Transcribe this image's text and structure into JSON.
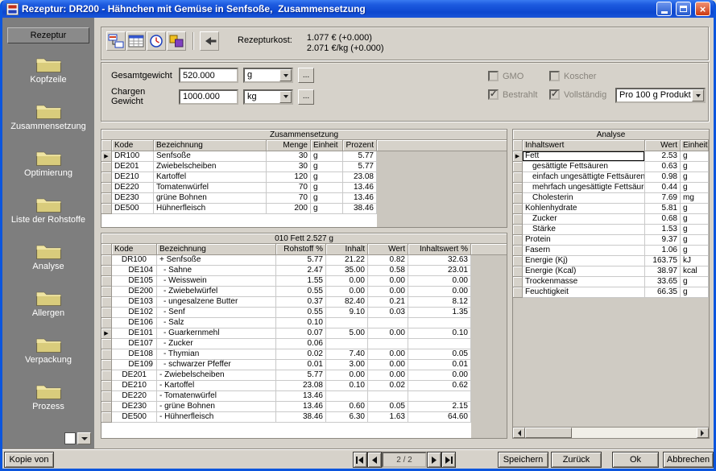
{
  "window": {
    "title": "Rezeptur: DR200 - Hähnchen mit Gemüse in Senfsoße,  Zusammensetzung"
  },
  "colors": {
    "titlebar_blue": "#1d5be0",
    "window_bg": "#d6d2ca",
    "sidebar_gray": "#7e7e7e",
    "folder_yellow": "#d9cc7c"
  },
  "sidebar": {
    "header": "Rezeptur",
    "items": [
      {
        "label": "Kopfzeile"
      },
      {
        "label": "Zusammensetzung"
      },
      {
        "label": "Optimierung"
      },
      {
        "label": "Liste der Rohstoffe"
      },
      {
        "label": "Analyse"
      },
      {
        "label": "Allergen"
      },
      {
        "label": "Verpackung"
      },
      {
        "label": "Prozess"
      }
    ]
  },
  "toolbar": {
    "cost_label": "Rezepturkost:",
    "cost_line1": "1.077 € (+0.000)",
    "cost_line2": "2.071 €/kg (+0.000)"
  },
  "form": {
    "gesamtgewicht": {
      "label": "Gesamtgewicht",
      "value": "520.000",
      "unit": "g"
    },
    "chargen": {
      "label": "Chargen Gewicht",
      "value": "1000.000",
      "unit": "kg"
    },
    "browse_label": "...",
    "checkboxes": [
      {
        "label": "GMO",
        "checked": false
      },
      {
        "label": "Koscher",
        "checked": false
      },
      {
        "label": "Bestrahlt",
        "checked": true
      },
      {
        "label": "Vollständig",
        "checked": true
      }
    ],
    "per_unit_dropdown": "Pro 100 g Produkt"
  },
  "composition_table": {
    "title": "Zusammensetzung",
    "columns": {
      "kode": "Kode",
      "bezeichnung": "Bezeichnung",
      "menge": "Menge",
      "einheit": "Einheit",
      "prozent": "Prozent"
    },
    "rows": [
      {
        "kode": "DR100",
        "bezeichnung": "Senfsoße",
        "menge": "30",
        "einheit": "g",
        "prozent": "5.77",
        "current": true
      },
      {
        "kode": "DE201",
        "bezeichnung": "Zwiebelscheiben",
        "menge": "30",
        "einheit": "g",
        "prozent": "5.77"
      },
      {
        "kode": "DE210",
        "bezeichnung": "Kartoffel",
        "menge": "120",
        "einheit": "g",
        "prozent": "23.08"
      },
      {
        "kode": "DE220",
        "bezeichnung": "Tomatenwürfel",
        "menge": "70",
        "einheit": "g",
        "prozent": "13.46"
      },
      {
        "kode": "DE230",
        "bezeichnung": "grüne Bohnen",
        "menge": "70",
        "einheit": "g",
        "prozent": "13.46"
      },
      {
        "kode": "DE500",
        "bezeichnung": "Hühnerfleisch",
        "menge": "200",
        "einheit": "g",
        "prozent": "38.46"
      }
    ]
  },
  "fett_table": {
    "title": "010 Fett 2.527 g",
    "columns": {
      "kode": "Kode",
      "bezeichnung": "Bezeichnung",
      "rohstoff": "Rohstoff %",
      "inhalt": "Inhalt",
      "wert": "Wert",
      "inhaltswert": "Inhaltswert %"
    },
    "rows": [
      {
        "kode": "DR100",
        "bezeichnung": "+ Senfsoße",
        "rohstoff": "5.77",
        "inhalt": "21.22",
        "wert": "0.82",
        "inhaltswert": "32.63"
      },
      {
        "kode": "DE104",
        "bezeichnung": "- Sahne",
        "rohstoff": "2.47",
        "inhalt": "35.00",
        "wert": "0.58",
        "inhaltswert": "23.01",
        "child": true
      },
      {
        "kode": "DE105",
        "bezeichnung": "- Weisswein",
        "rohstoff": "1.55",
        "inhalt": "0.00",
        "wert": "0.00",
        "inhaltswert": "0.00",
        "child": true
      },
      {
        "kode": "DE200",
        "bezeichnung": "- Zwiebelwürfel",
        "rohstoff": "0.55",
        "inhalt": "0.00",
        "wert": "0.00",
        "inhaltswert": "0.00",
        "child": true
      },
      {
        "kode": "DE103",
        "bezeichnung": "- ungesalzene Butter",
        "rohstoff": "0.37",
        "inhalt": "82.40",
        "wert": "0.21",
        "inhaltswert": "8.12",
        "child": true
      },
      {
        "kode": "DE102",
        "bezeichnung": "- Senf",
        "rohstoff": "0.55",
        "inhalt": "9.10",
        "wert": "0.03",
        "inhaltswert": "1.35",
        "child": true
      },
      {
        "kode": "DE106",
        "bezeichnung": "- Salz",
        "rohstoff": "0.10",
        "inhalt": "",
        "wert": "",
        "inhaltswert": "",
        "child": true
      },
      {
        "kode": "DE101",
        "bezeichnung": "- Guarkernmehl",
        "rohstoff": "0.07",
        "inhalt": "5.00",
        "wert": "0.00",
        "inhaltswert": "0.10",
        "child": true,
        "current": true
      },
      {
        "kode": "DE107",
        "bezeichnung": "- Zucker",
        "rohstoff": "0.06",
        "inhalt": "",
        "wert": "",
        "inhaltswert": "",
        "child": true
      },
      {
        "kode": "DE108",
        "bezeichnung": "- Thymian",
        "rohstoff": "0.02",
        "inhalt": "7.40",
        "wert": "0.00",
        "inhaltswert": "0.05",
        "child": true
      },
      {
        "kode": "DE109",
        "bezeichnung": "- schwarzer Pfeffer",
        "rohstoff": "0.01",
        "inhalt": "3.00",
        "wert": "0.00",
        "inhaltswert": "0.01",
        "child": true
      },
      {
        "kode": "DE201",
        "bezeichnung": "- Zwiebelscheiben",
        "rohstoff": "5.77",
        "inhalt": "0.00",
        "wert": "0.00",
        "inhaltswert": "0.00"
      },
      {
        "kode": "DE210",
        "bezeichnung": "- Kartoffel",
        "rohstoff": "23.08",
        "inhalt": "0.10",
        "wert": "0.02",
        "inhaltswert": "0.62"
      },
      {
        "kode": "DE220",
        "bezeichnung": "- Tomatenwürfel",
        "rohstoff": "13.46",
        "inhalt": "",
        "wert": "",
        "inhaltswert": ""
      },
      {
        "kode": "DE230",
        "bezeichnung": "- grüne Bohnen",
        "rohstoff": "13.46",
        "inhalt": "0.60",
        "wert": "0.05",
        "inhaltswert": "2.15"
      },
      {
        "kode": "DE500",
        "bezeichnung": "- Hühnerfleisch",
        "rohstoff": "38.46",
        "inhalt": "6.30",
        "wert": "1.63",
        "inhaltswert": "64.60"
      }
    ]
  },
  "analysis_table": {
    "title": "Analyse",
    "columns": {
      "name": "Inhaltswert",
      "wert": "Wert",
      "einheit": "Einheit"
    },
    "rows": [
      {
        "name": "Fett",
        "wert": "2.53",
        "einheit": "g",
        "current": true,
        "focused": true
      },
      {
        "name": "gesättigte Fettsäuren",
        "wert": "0.63",
        "einheit": "g",
        "child": true
      },
      {
        "name": "einfach ungesättigte Fettsäuren",
        "wert": "0.98",
        "einheit": "g",
        "child": true
      },
      {
        "name": "mehrfach ungesättigte Fettsäuren",
        "wert": "0.44",
        "einheit": "g",
        "child": true
      },
      {
        "name": "Cholesterin",
        "wert": "7.69",
        "einheit": "mg",
        "child": true
      },
      {
        "name": "Kohlenhydrate",
        "wert": "5.81",
        "einheit": "g"
      },
      {
        "name": "Zucker",
        "wert": "0.68",
        "einheit": "g",
        "child": true
      },
      {
        "name": "Stärke",
        "wert": "1.53",
        "einheit": "g",
        "child": true
      },
      {
        "name": "Protein",
        "wert": "9.37",
        "einheit": "g"
      },
      {
        "name": "Fasern",
        "wert": "1.06",
        "einheit": "g"
      },
      {
        "name": "Energie (Kj)",
        "wert": "163.75",
        "einheit": "kJ"
      },
      {
        "name": "Energie (Kcal)",
        "wert": "38.97",
        "einheit": "kcal"
      },
      {
        "name": "Trockenmasse",
        "wert": "33.65",
        "einheit": "g"
      },
      {
        "name": "Feuchtigkeit",
        "wert": "66.35",
        "einheit": "g"
      }
    ]
  },
  "footer": {
    "copy_button": "Kopie von",
    "page_indicator": "2 / 2",
    "save_button": "Speichern",
    "back_button": "Zurück",
    "ok_button": "Ok",
    "cancel_button": "Abbrechen"
  }
}
